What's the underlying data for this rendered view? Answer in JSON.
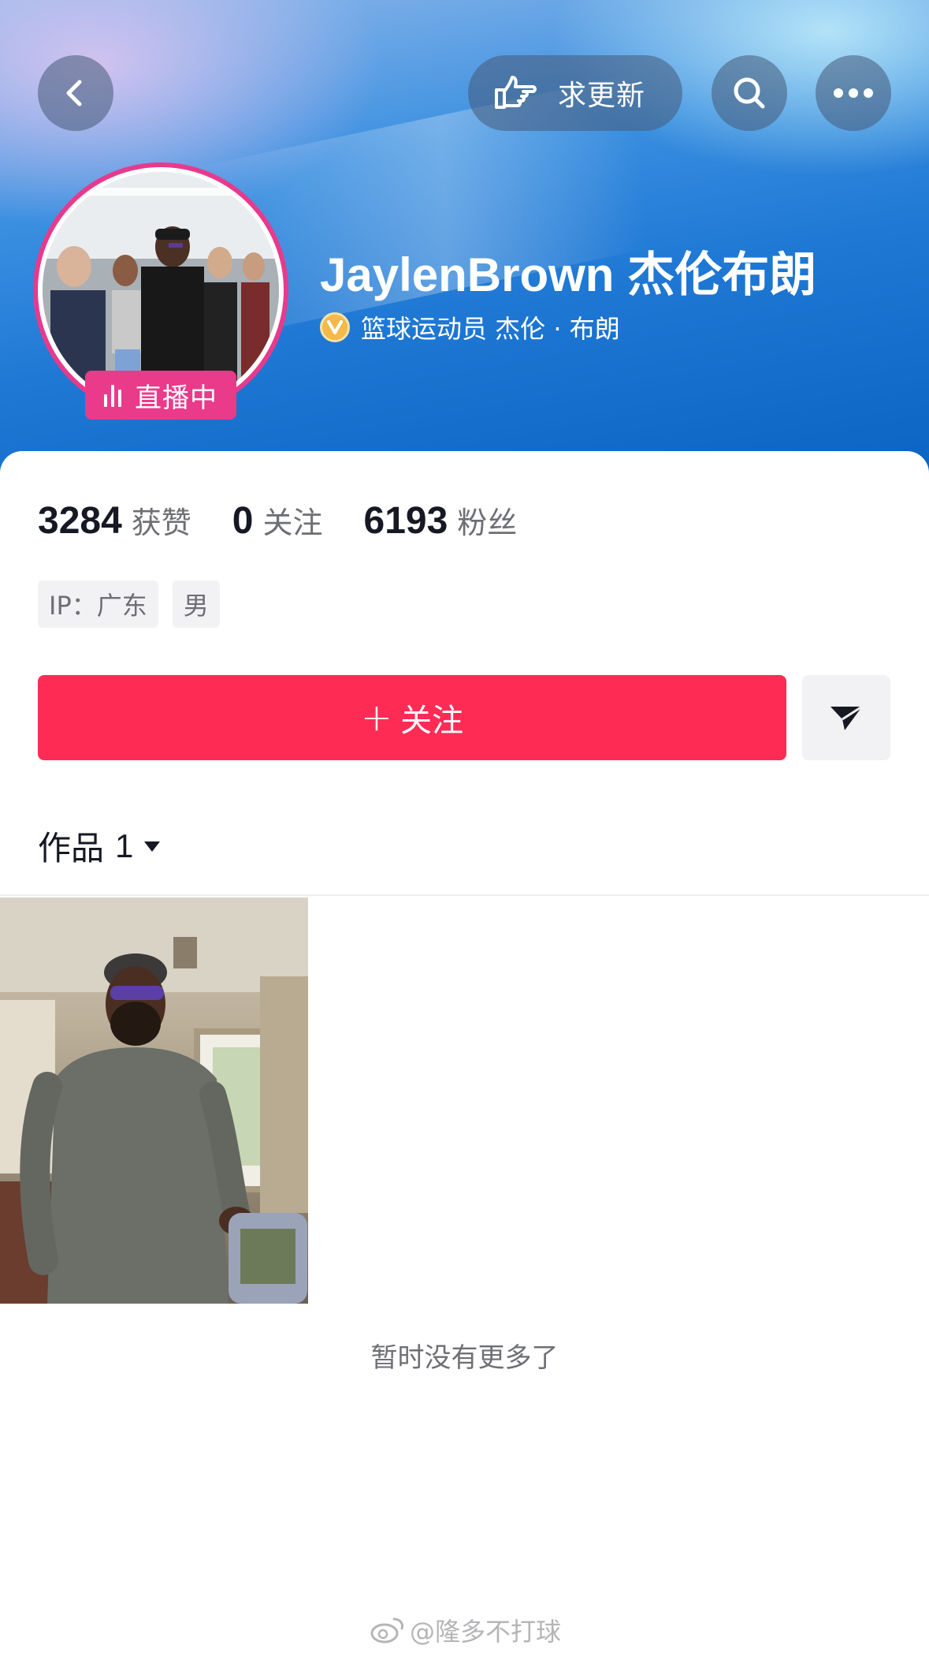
{
  "header": {
    "request_update_label": "求更新",
    "icons": [
      "back-icon",
      "pointing-hand-icon",
      "search-icon",
      "more-icon"
    ]
  },
  "profile": {
    "name": "JaylenBrown 杰伦布朗",
    "verification": "篮球运动员 杰伦 · 布朗",
    "live_badge": "直播中"
  },
  "stats": [
    {
      "value": "3284",
      "label": "获赞"
    },
    {
      "value": "0",
      "label": "关注"
    },
    {
      "value": "6193",
      "label": "粉丝"
    }
  ],
  "tags": [
    "IP：广东",
    "男"
  ],
  "actions": {
    "follow_label": "关注",
    "follow_plus": "+"
  },
  "works": {
    "label": "作品",
    "count": "1"
  },
  "feed": {
    "end_text": "暂时没有更多了"
  },
  "watermark": "@隆多不打球",
  "colors": {
    "follow_button": "#fe2c55",
    "live_badge": "#ea3a8a",
    "banner_blue": "#1f78d4",
    "verify_badge": "#f4b94a"
  }
}
